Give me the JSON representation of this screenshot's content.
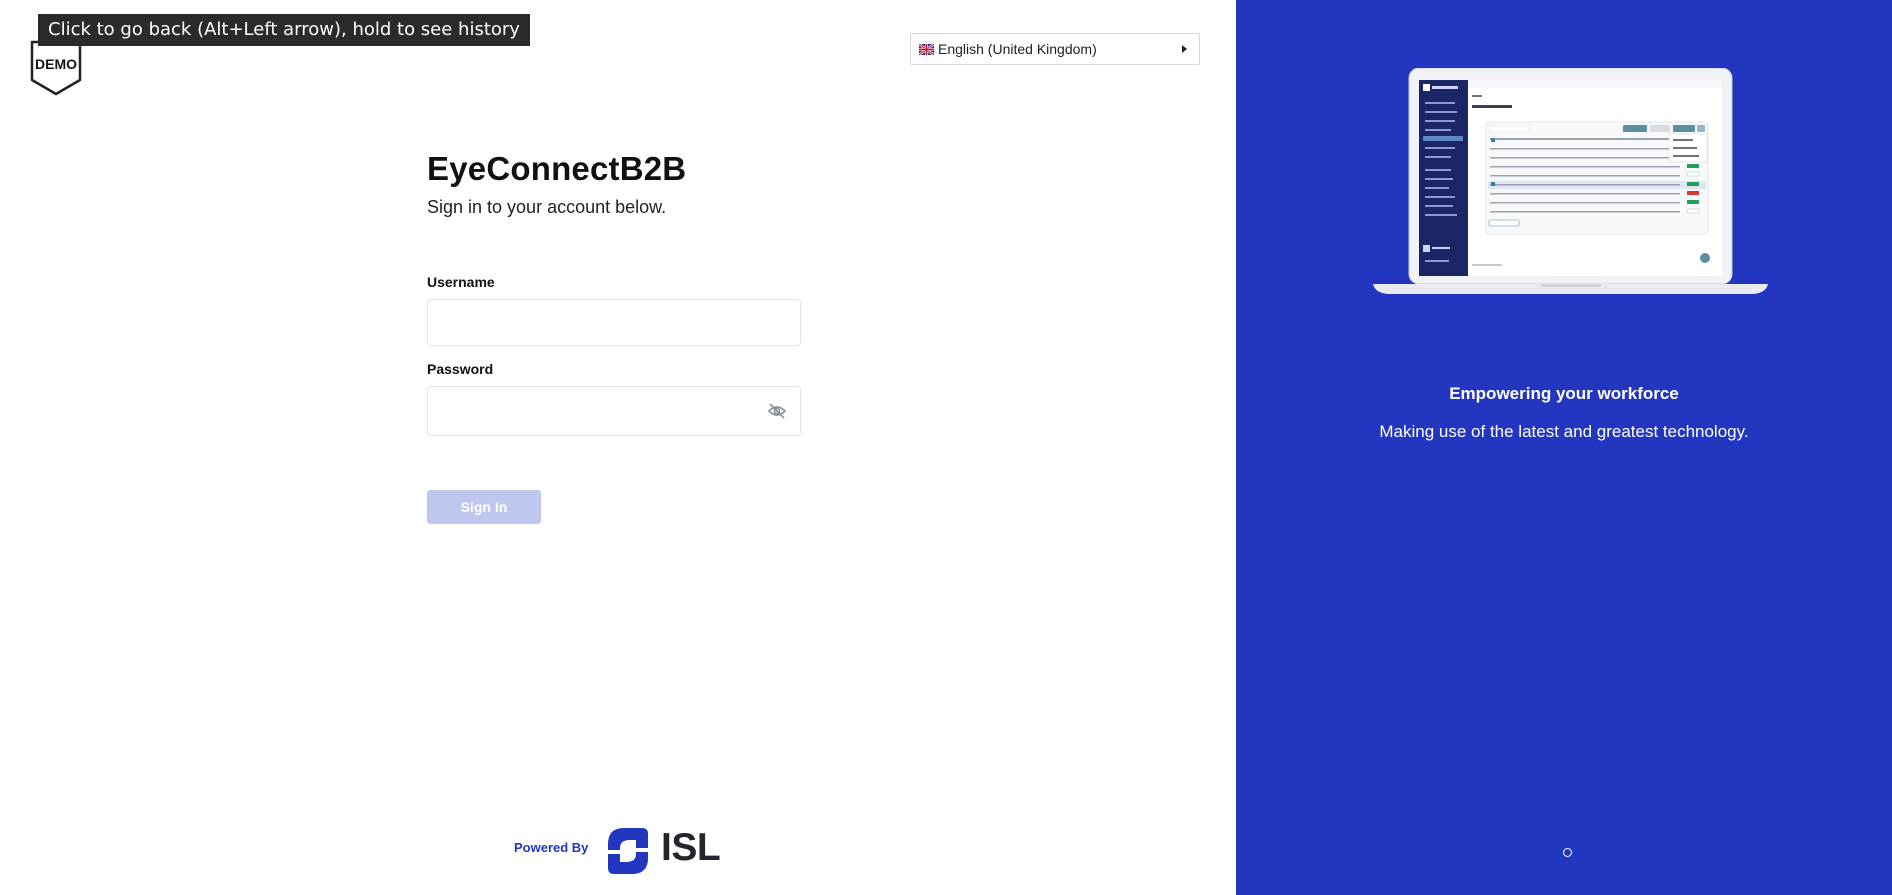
{
  "browser": {
    "back_tooltip": "Click to go back (Alt+Left arrow), hold to see history"
  },
  "badge": {
    "label": "DEMO"
  },
  "language_selector": {
    "flag_icon": "uk-flag-icon",
    "value": "English (United Kingdom)"
  },
  "login": {
    "brand": "EyeConnectB2B",
    "subtitle": "Sign in to your account below.",
    "username_label": "Username",
    "username_value": "",
    "password_label": "Password",
    "password_value": "",
    "password_toggle_icon": "eye-off-icon",
    "sign_in_label": "Sign In"
  },
  "footer": {
    "powered_by": "Powered By",
    "company": "ISL"
  },
  "promo": {
    "title": "Empowering your workforce",
    "subtitle": "Making use of the latest and greatest technology.",
    "carousel_dots": 1
  },
  "colors": {
    "accent": "#2336bf",
    "button_disabled": "#c0c7ef",
    "logo_blue": "#2336bf"
  }
}
